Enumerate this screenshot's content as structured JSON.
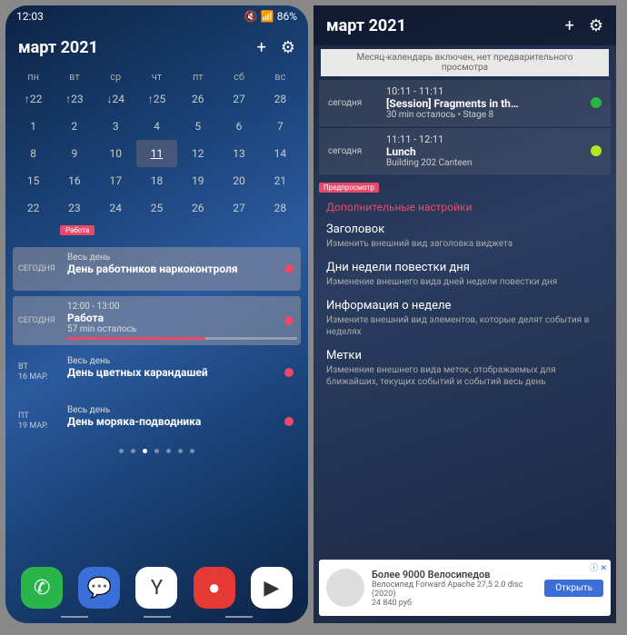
{
  "left": {
    "status": {
      "time": "12:03",
      "battery": "86%",
      "icons": "⚡"
    },
    "header": {
      "title": "март 2021"
    },
    "weekdays": [
      "пн",
      "вт",
      "ср",
      "чт",
      "пт",
      "сб",
      "вс"
    ],
    "calendar": [
      [
        "↑22",
        "↑23",
        "↓24",
        "↑25",
        "26",
        "27",
        "28"
      ],
      [
        "1",
        "2",
        "3",
        "4",
        "5",
        "6",
        "7"
      ],
      [
        "8",
        "9",
        "10",
        "11",
        "12",
        "13",
        "14"
      ],
      [
        "15",
        "16",
        "17",
        "18",
        "19",
        "20",
        "21"
      ],
      [
        "22",
        "23",
        "24",
        "25",
        "26",
        "27",
        "28"
      ]
    ],
    "today_cell": "11",
    "timeline_badge": "Работа",
    "events": [
      {
        "date_top": "СЕГОДНЯ",
        "date_bot": "",
        "time": "Весь день",
        "title": "День работников наркоконтроля",
        "remaining": "",
        "color": "#e94a6b",
        "highlight": true,
        "progress": false
      },
      {
        "date_top": "СЕГОДНЯ",
        "date_bot": "",
        "time": "12:00 - 13:00",
        "title": "Работа",
        "remaining": "57 min осталось",
        "color": "#e94a6b",
        "highlight": true,
        "progress": true
      },
      {
        "date_top": "ВТ",
        "date_bot": "16 МАР.",
        "time": "Весь день",
        "title": "День цветных карандашей",
        "remaining": "",
        "color": "#e94a6b",
        "highlight": false,
        "progress": false
      },
      {
        "date_top": "ПТ",
        "date_bot": "19 МАР.",
        "time": "Весь день",
        "title": "День моряка-подводника",
        "remaining": "",
        "color": "#e94a6b",
        "highlight": false,
        "progress": false
      }
    ],
    "dock": [
      {
        "bg": "#2ab54a",
        "glyph": "✆"
      },
      {
        "bg": "#3a6fd8",
        "glyph": "💬"
      },
      {
        "bg": "#ffffff",
        "glyph": "Y"
      },
      {
        "bg": "#e53935",
        "glyph": "●"
      },
      {
        "bg": "#ffffff",
        "glyph": "▶"
      }
    ]
  },
  "right": {
    "header": {
      "title": "март 2021"
    },
    "banner": "Месяц-календарь включен, нет предварительного просмотра",
    "events": [
      {
        "label": "сегодня",
        "time": "10:11 - 11:11",
        "title": "[Session] Fragments in th…",
        "sub": "30 min осталось   •   Stage 8",
        "color": "#2ab54a"
      },
      {
        "label": "сегодня",
        "time": "11:11 - 12:11",
        "title": "Lunch",
        "sub": "Building 202 Canteen",
        "color": "#b6e61d"
      }
    ],
    "preview_badge": "Предпросмотр",
    "settings_head": "Дополнительные настройки",
    "settings": [
      {
        "title": "Заголовок",
        "desc": "Изменить внешний вид заголовка виджета"
      },
      {
        "title": "Дни недели повестки дня",
        "desc": "Изменение внешнего вида дней недели повестки дня"
      },
      {
        "title": "Информация о неделе",
        "desc": "Измените внешний вид элементов, которые делят события в неделях"
      },
      {
        "title": "Метки",
        "desc": "Изменение внешнего вида меток, отображаемых для ближайших, текущих событий и событий весь день"
      }
    ],
    "ad": {
      "headline": "Более 9000 Велосипедов",
      "sub": "Велосипед Forward Apache 27,5 2.0 disc (2020)",
      "price": "24 840 руб",
      "cta": "Открыть",
      "close": "ⓘ ✕"
    }
  }
}
